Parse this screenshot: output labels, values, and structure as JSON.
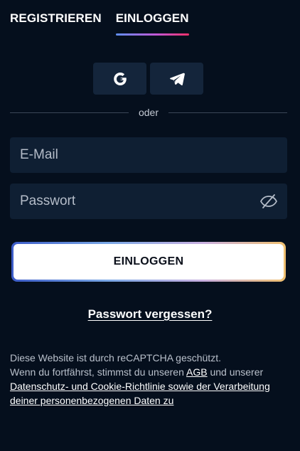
{
  "tabs": [
    {
      "label": "REGISTRIEREN",
      "active": false
    },
    {
      "label": "EINLOGGEN",
      "active": true
    }
  ],
  "social": {
    "google_icon": "google-icon",
    "telegram_icon": "telegram-icon"
  },
  "divider_text": "oder",
  "email": {
    "placeholder": "E-Mail",
    "value": ""
  },
  "password": {
    "placeholder": "Passwort",
    "value": "",
    "toggle_icon": "eye-off-icon"
  },
  "login_button": "EINLOGGEN",
  "forgot_password": "Passwort vergessen?",
  "legal": {
    "line1": "Diese Website ist durch reCAPTCHA geschützt.",
    "line2_prefix": "Wenn du fortfährst, stimmst du unseren",
    "agb_link": "AGB",
    "line2_suffix": "und unserer",
    "privacy_link": "Datenschutz- und Cookie-Richtlinie sowie der Verarbeitung deiner personenbezogenen Daten zu"
  },
  "colors": {
    "background": "#050f1d",
    "field": "#0f1f33",
    "social_button": "#14253b",
    "tab_underline_start": "#5f8ff0",
    "tab_underline_end": "#f0306a"
  }
}
